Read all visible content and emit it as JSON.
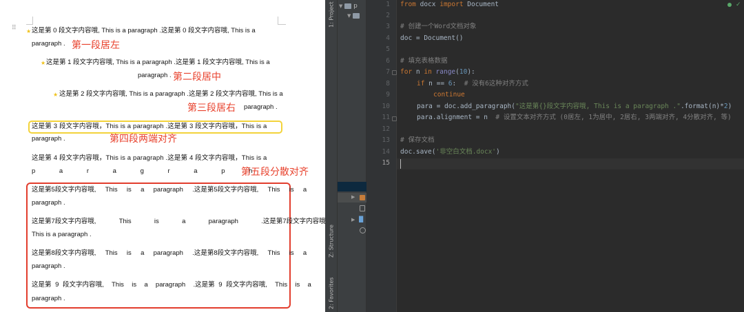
{
  "document": {
    "paragraphs": [
      {
        "lines": [
          "这是第 0 段文字内容哦, This is a paragraph .这是第 0 段文字内容哦, This is a",
          "paragraph ."
        ]
      },
      {
        "lines": [
          "这是第 1 段文字内容哦, This is a paragraph .这是第 1 段文字内容哦, This is a",
          "paragraph ."
        ]
      },
      {
        "lines": [
          "这是第 2 段文字内容哦, This is a paragraph .这是第 2 段文字内容哦, This is a",
          "paragraph ."
        ]
      },
      {
        "lines": [
          "这是第 3 段文字内容哦，This is a paragraph .这是第 3 段文字内容哦，This is a",
          "paragraph ."
        ]
      },
      {
        "lines": [
          "这是第 4 段文字内容哦，This is a paragraph .这是第 4 段文字内容哦，This is a",
          "p a r a g r a p h"
        ]
      },
      {
        "lines": [
          "这是第5段文字内容哦,  This  is  a  paragraph  .这是第5段文字内容哦,  This  is  a",
          "paragraph ."
        ]
      },
      {
        "lines": [
          "这是第7段文字内容哦,  This  is  a  paragraph  .这是第7段文字内容哦,",
          "This is a paragraph ."
        ]
      },
      {
        "lines": [
          "这是第8段文字内容哦,  This  is  a  paragraph  .这是第8段文字内容哦,  This  is  a",
          "paragraph ."
        ]
      },
      {
        "lines": [
          "这是第 9 段文字内容哦,  This  is  a  paragraph  .这是第 9 段文字内容哦,  This  is  a",
          "paragraph ."
        ]
      }
    ],
    "annotations": [
      "第一段居左",
      "第二段居中",
      "第三段居右",
      "第四段两端对齐",
      "第五段分散对齐"
    ]
  },
  "ide": {
    "tool_windows": {
      "project": "1: Project",
      "structure": "Z: Structure",
      "favorites": "2: Favorites"
    },
    "project_tree": [
      "p",
      ""
    ],
    "line_numbers": [
      "1",
      "2",
      "3",
      "4",
      "5",
      "6",
      "7",
      "8",
      "9",
      "10",
      "11",
      "12",
      "13",
      "14",
      "15"
    ],
    "code": {
      "l1": [
        "from",
        " docx ",
        "import",
        " Document"
      ],
      "l3": "# 创建一个Word文档对象",
      "l4": "doc = Document()",
      "l6": "# 填充表格数据",
      "l7": [
        "for",
        " n ",
        "in",
        " ",
        "range",
        "(",
        "10",
        "):"
      ],
      "l8": [
        "if",
        " n == ",
        "6",
        ":  ",
        "# 没有6这种对齐方式"
      ],
      "l9": "continue",
      "l10": [
        "para = doc.add_paragraph(",
        "\"这是第{}段文字内容哦, This is a paragraph .\"",
        ".format(n)*",
        "2",
        ")"
      ],
      "l11": [
        "para.alignment = n  ",
        "# 设置文本对齐方式 (0居左, 1为居中, 2居右, 3两端对齐, 4分散对齐, 等)"
      ],
      "l13": "# 保存文档",
      "l14": [
        "doc.save(",
        "'非空白文档.docx'",
        ")"
      ]
    },
    "colors": {
      "keyword": "#cc7832",
      "comment": "#808080",
      "string": "#6a8759",
      "number": "#6897bb",
      "builtin": "#8888c6",
      "text": "#a9b7c6"
    }
  }
}
